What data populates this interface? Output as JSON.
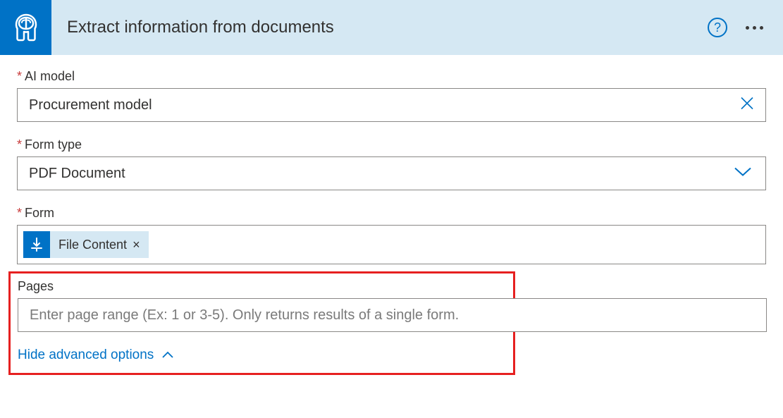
{
  "header": {
    "title": "Extract information from documents"
  },
  "fields": {
    "ai_model": {
      "label": "AI model",
      "value": "Procurement model"
    },
    "form_type": {
      "label": "Form type",
      "value": "PDF Document"
    },
    "form": {
      "label": "Form",
      "token_label": "File Content"
    },
    "pages": {
      "label": "Pages",
      "placeholder": "Enter page range (Ex: 1 or 3-5). Only returns results of a single form."
    }
  },
  "links": {
    "advanced": "Hide advanced options"
  }
}
